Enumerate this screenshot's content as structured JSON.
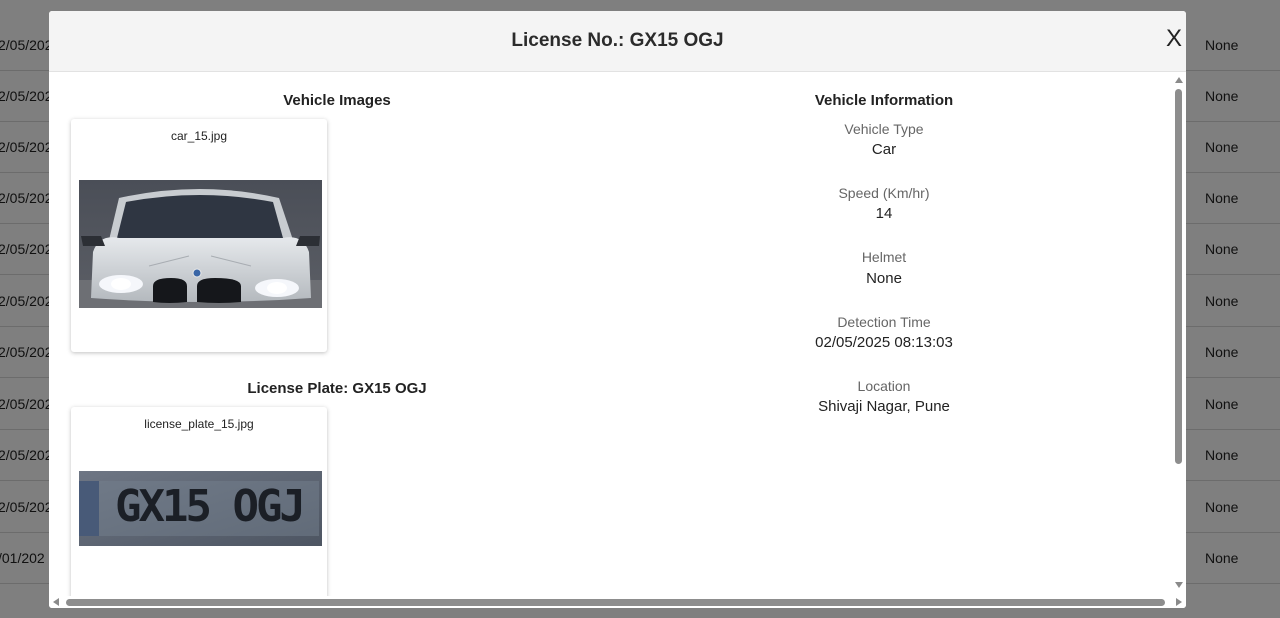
{
  "background_table": {
    "rows": [
      {
        "date": "2/05/202",
        "status": "None"
      },
      {
        "date": "2/05/202",
        "status": "None"
      },
      {
        "date": "2/05/202",
        "status": "None"
      },
      {
        "date": "2/05/202",
        "status": "None"
      },
      {
        "date": "2/05/202",
        "status": "None"
      },
      {
        "date": "2/05/202",
        "status": "None"
      },
      {
        "date": "2/05/202",
        "status": "None"
      },
      {
        "date": "2/05/202",
        "status": "None"
      },
      {
        "date": "2/05/202",
        "status": "None"
      },
      {
        "date": "2/05/202",
        "status": "None"
      },
      {
        "date": "/01/202",
        "status": "None"
      }
    ]
  },
  "modal": {
    "title": "License No.: GX15 OGJ",
    "close_label": "X"
  },
  "images": {
    "section_title": "Vehicle Images",
    "car_caption": "car_15.jpg",
    "plate_section_title": "License Plate: GX15 OGJ",
    "plate_caption": "license_plate_15.jpg",
    "plate_text": "GX15 OGJ"
  },
  "info": {
    "section_title": "Vehicle Information",
    "fields": [
      {
        "label": "Vehicle Type",
        "value": "Car"
      },
      {
        "label": "Speed (Km/hr)",
        "value": "14"
      },
      {
        "label": "Helmet",
        "value": "None"
      },
      {
        "label": "Detection Time",
        "value": "02/05/2025 08:13:03"
      },
      {
        "label": "Location",
        "value": "Shivaji Nagar, Pune"
      }
    ]
  }
}
